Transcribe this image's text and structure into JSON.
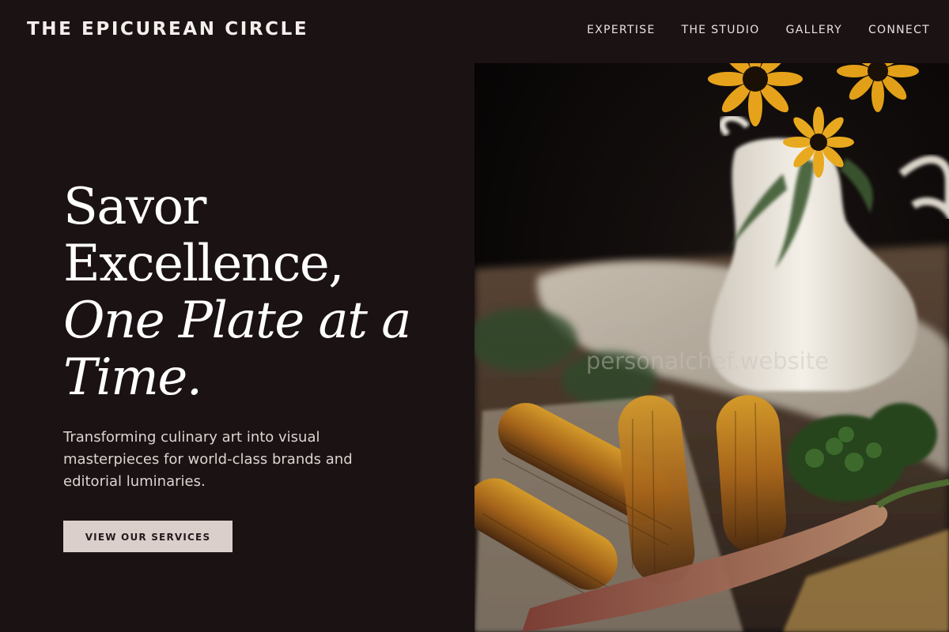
{
  "header": {
    "brand": "THE EPICUREAN CIRCLE",
    "nav": [
      {
        "label": "EXPERTISE"
      },
      {
        "label": "THE STUDIO"
      },
      {
        "label": "GALLERY"
      },
      {
        "label": "CONNECT"
      }
    ]
  },
  "hero": {
    "headline": {
      "line1": "Savor",
      "line2": "Excellence,",
      "line3": "One Plate at a",
      "line4": "Time."
    },
    "lede": "Transforming culinary art into visual masterpieces for world-class brands and editorial luminaries.",
    "cta_label": "VIEW OUR SERVICES"
  },
  "photo": {
    "watermark": "personalchef.website"
  },
  "colors": {
    "background": "#1b1213",
    "button": "#dbcfcc",
    "text": "#ffffff"
  }
}
